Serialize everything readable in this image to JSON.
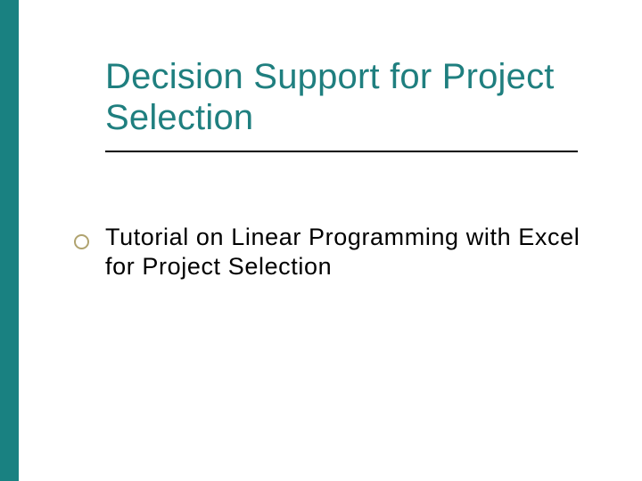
{
  "slide": {
    "title": "Decision Support for Project Selection",
    "subtitle": "Tutorial on Linear Programming with Excel for Project Selection"
  },
  "colors": {
    "accent_bar": "#198181",
    "title_color": "#1f7f7f",
    "bullet_ring": "#b0a36f",
    "rule": "#000000"
  }
}
